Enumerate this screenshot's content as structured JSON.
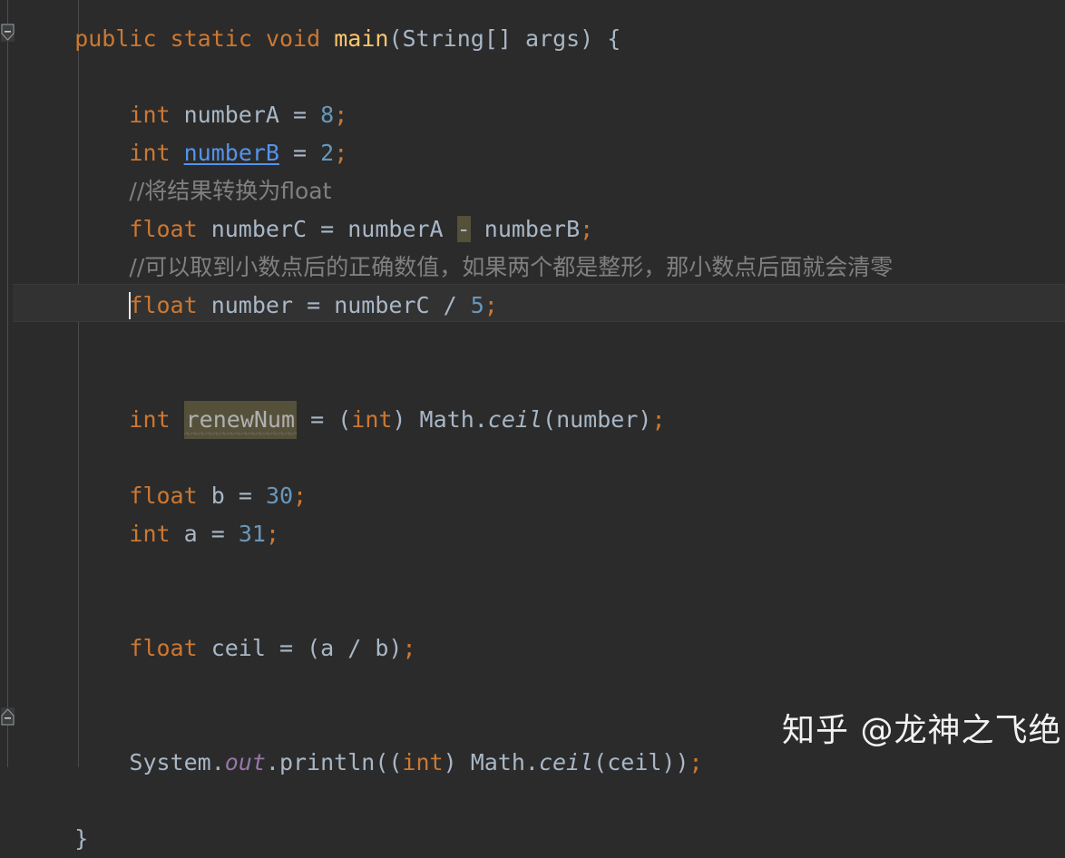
{
  "editor": {
    "theme_name": "darcula",
    "colors": {
      "background": "#2b2b2b",
      "caret_row_background": "#323232",
      "keyword": "#cc7832",
      "number": "#6897bb",
      "identifier": "#a9b7c6",
      "method_declaration": "#ffc66d",
      "comment": "#808080",
      "static_field": "#9876aa",
      "highlight_olive": "#55503a",
      "link_identifier": "#5394ec",
      "caret": "#e8e8e8",
      "indent_guide": "#4a4a4a"
    },
    "gutter": {
      "fold_marker_top": "collapse-fold-icon",
      "fold_marker_bottom": "collapse-fold-icon"
    },
    "caret": {
      "line_index": 7,
      "column": 8
    },
    "lines": [
      {
        "index": 0,
        "indent": 4,
        "tokens": [
          {
            "t": "public",
            "c": "kw"
          },
          {
            "t": " ",
            "c": "plain"
          },
          {
            "t": "static",
            "c": "kw"
          },
          {
            "t": " ",
            "c": "plain"
          },
          {
            "t": "void",
            "c": "kw"
          },
          {
            "t": " ",
            "c": "plain"
          },
          {
            "t": "main",
            "c": "method"
          },
          {
            "t": "(",
            "c": "punc"
          },
          {
            "t": "String[] args",
            "c": "plain"
          },
          {
            "t": ") {",
            "c": "punc"
          }
        ]
      },
      {
        "index": 1,
        "indent": 8,
        "tokens": []
      },
      {
        "index": 2,
        "indent": 8,
        "tokens": [
          {
            "t": "int",
            "c": "kw"
          },
          {
            "t": " numberA ",
            "c": "plain"
          },
          {
            "t": "=",
            "c": "plain"
          },
          {
            "t": " ",
            "c": "plain"
          },
          {
            "t": "8",
            "c": "num"
          },
          {
            "t": ";",
            "c": "semi"
          }
        ]
      },
      {
        "index": 3,
        "indent": 8,
        "tokens": [
          {
            "t": "int",
            "c": "kw"
          },
          {
            "t": " ",
            "c": "plain"
          },
          {
            "t": "numberB",
            "c": "ident-link"
          },
          {
            "t": " ",
            "c": "plain"
          },
          {
            "t": "=",
            "c": "plain"
          },
          {
            "t": " ",
            "c": "plain"
          },
          {
            "t": "2",
            "c": "num"
          },
          {
            "t": ";",
            "c": "semi"
          }
        ]
      },
      {
        "index": 4,
        "indent": 8,
        "tokens": [
          {
            "t": "//将结果转换为float",
            "c": "cmt"
          }
        ]
      },
      {
        "index": 5,
        "indent": 8,
        "tokens": [
          {
            "t": "float",
            "c": "kw"
          },
          {
            "t": " numberC ",
            "c": "plain"
          },
          {
            "t": "=",
            "c": "plain"
          },
          {
            "t": " numberA ",
            "c": "plain"
          },
          {
            "t": "-",
            "c": "hl"
          },
          {
            "t": " numberB",
            "c": "plain"
          },
          {
            "t": ";",
            "c": "semi"
          }
        ]
      },
      {
        "index": 6,
        "indent": 8,
        "tokens": [
          {
            "t": "//可以取到小数点后的正确数值，如果两个都是整形，那小数点后面就会清零",
            "c": "cmt"
          }
        ]
      },
      {
        "index": 7,
        "indent": 8,
        "tokens": [
          {
            "t": "float",
            "c": "kw"
          },
          {
            "t": " number ",
            "c": "plain"
          },
          {
            "t": "=",
            "c": "plain"
          },
          {
            "t": " numberC ",
            "c": "plain"
          },
          {
            "t": "/",
            "c": "plain"
          },
          {
            "t": " ",
            "c": "plain"
          },
          {
            "t": "5",
            "c": "num"
          },
          {
            "t": ";",
            "c": "semi"
          }
        ]
      },
      {
        "index": 8,
        "indent": 8,
        "tokens": []
      },
      {
        "index": 9,
        "indent": 8,
        "tokens": [],
        "is_caret_line": true
      },
      {
        "index": 10,
        "indent": 8,
        "tokens": [
          {
            "t": "int",
            "c": "kw"
          },
          {
            "t": " ",
            "c": "plain"
          },
          {
            "t": "renewNum",
            "c": "hl-warn"
          },
          {
            "t": " ",
            "c": "plain"
          },
          {
            "t": "=",
            "c": "plain"
          },
          {
            "t": " (",
            "c": "punc"
          },
          {
            "t": "int",
            "c": "kw"
          },
          {
            "t": ")",
            "c": "punc"
          },
          {
            "t": " Math.",
            "c": "plain"
          },
          {
            "t": "ceil",
            "c": "statm"
          },
          {
            "t": "(number)",
            "c": "plain"
          },
          {
            "t": ";",
            "c": "semi"
          }
        ]
      },
      {
        "index": 11,
        "indent": 8,
        "tokens": []
      },
      {
        "index": 12,
        "indent": 8,
        "tokens": [
          {
            "t": "float",
            "c": "kw"
          },
          {
            "t": " b ",
            "c": "plain"
          },
          {
            "t": "=",
            "c": "plain"
          },
          {
            "t": " ",
            "c": "plain"
          },
          {
            "t": "30",
            "c": "num"
          },
          {
            "t": ";",
            "c": "semi"
          }
        ]
      },
      {
        "index": 13,
        "indent": 8,
        "tokens": [
          {
            "t": "int",
            "c": "kw"
          },
          {
            "t": " a ",
            "c": "plain"
          },
          {
            "t": "=",
            "c": "plain"
          },
          {
            "t": " ",
            "c": "plain"
          },
          {
            "t": "31",
            "c": "num"
          },
          {
            "t": ";",
            "c": "semi"
          }
        ]
      },
      {
        "index": 14,
        "indent": 8,
        "tokens": []
      },
      {
        "index": 15,
        "indent": 8,
        "tokens": []
      },
      {
        "index": 16,
        "indent": 8,
        "tokens": [
          {
            "t": "float",
            "c": "kw"
          },
          {
            "t": " ceil ",
            "c": "plain"
          },
          {
            "t": "=",
            "c": "plain"
          },
          {
            "t": " (a ",
            "c": "plain"
          },
          {
            "t": "/",
            "c": "plain"
          },
          {
            "t": " b)",
            "c": "plain"
          },
          {
            "t": ";",
            "c": "semi"
          }
        ]
      },
      {
        "index": 17,
        "indent": 8,
        "tokens": []
      },
      {
        "index": 18,
        "indent": 8,
        "tokens": []
      },
      {
        "index": 19,
        "indent": 8,
        "tokens": [
          {
            "t": "System.",
            "c": "plain"
          },
          {
            "t": "out",
            "c": "stat"
          },
          {
            "t": ".println((",
            "c": "plain"
          },
          {
            "t": "int",
            "c": "kw"
          },
          {
            "t": ")",
            "c": "punc"
          },
          {
            "t": " Math.",
            "c": "plain"
          },
          {
            "t": "ceil",
            "c": "statm"
          },
          {
            "t": "(ceil))",
            "c": "plain"
          },
          {
            "t": ";",
            "c": "semi"
          }
        ]
      },
      {
        "index": 20,
        "indent": 8,
        "tokens": []
      },
      {
        "index": 21,
        "indent": 4,
        "tokens": [
          {
            "t": "}",
            "c": "plain"
          }
        ]
      }
    ]
  },
  "watermark": {
    "text": "知乎 @龙神之飞绝"
  }
}
